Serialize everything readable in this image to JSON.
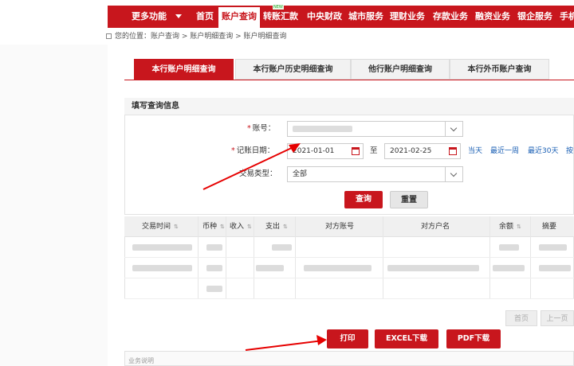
{
  "nav": {
    "more": "更多功能",
    "items": [
      "首页",
      "账户查询",
      "转账汇款",
      "中央财政",
      "城市服务",
      "理财业务",
      "存款业务",
      "融资业务",
      "银企服务",
      "手机"
    ],
    "new_badge": "NEW"
  },
  "breadcrumb": "您的位置：账户查询 > 账户明细查询 > 账户明细查询",
  "tabs": [
    "本行账户明细查询",
    "本行账户历史明细查询",
    "他行账户明细查询",
    "本行外币账户查询"
  ],
  "form": {
    "title": "填写查询信息",
    "account_label": "账号：",
    "date_label": "记账日期：",
    "date_from": "2021-01-01",
    "to": "至",
    "date_to": "2021-02-25",
    "quick": [
      "当天",
      "最近一周",
      "最近30天",
      "按"
    ],
    "type_label": "交易类型：",
    "type_value": "全部",
    "query": "查询",
    "reset": "重置"
  },
  "table": {
    "headers": [
      "交易时间",
      "币种",
      "收入",
      "支出",
      "对方账号",
      "对方户名",
      "余额",
      "摘要"
    ]
  },
  "pager": [
    "首页",
    "上一页"
  ],
  "actions": [
    "打印",
    "EXCEL下载",
    "PDF下载"
  ],
  "footer": "业务说明",
  "colors": {
    "brand_red": "#c8161d",
    "link_blue": "#1a5fb4"
  }
}
